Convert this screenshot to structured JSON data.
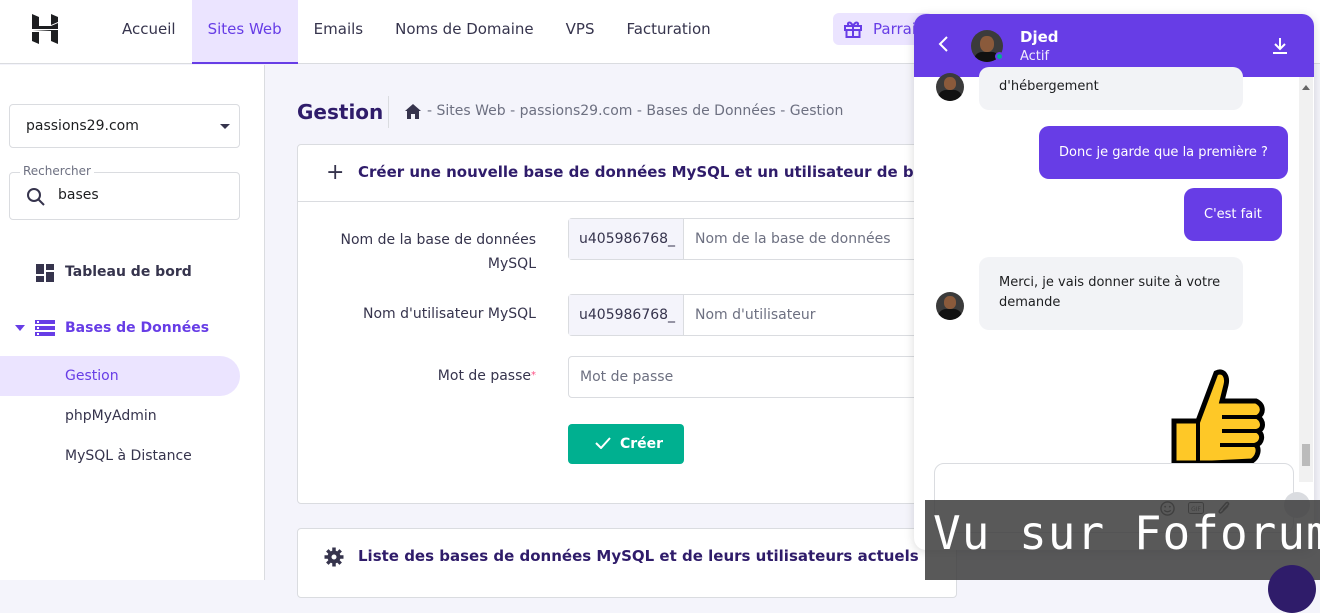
{
  "topbar": {
    "nav": [
      "Accueil",
      "Sites Web",
      "Emails",
      "Noms de Domaine",
      "VPS",
      "Facturation"
    ],
    "active_nav": "Sites Web",
    "referral_label": "Parrai"
  },
  "sidebar": {
    "domain": "passions29.com",
    "search_label": "Rechercher",
    "search_value": "bases",
    "dashboard_label": "Tableau de bord",
    "section_label": "Bases de Données",
    "subitems": [
      "Gestion",
      "phpMyAdmin",
      "MySQL à Distance"
    ]
  },
  "main": {
    "title": "Gestion",
    "breadcrumb": "- Sites Web - passions29.com - Bases de Données - Gestion",
    "create_card": {
      "title": "Créer une nouvelle base de données MySQL et un utilisateur de base de",
      "db_label_1": "Nom de la base de données",
      "db_label_2": "MySQL",
      "db_prefix": "u405986768_",
      "db_placeholder": "Nom de la base de données",
      "user_label": "Nom d'utilisateur MySQL",
      "user_prefix": "u405986768_",
      "user_placeholder": "Nom d'utilisateur",
      "password_label": "Mot de passe",
      "password_required": "*",
      "password_placeholder": "Mot de passe",
      "submit_label": "Créer"
    },
    "list_card_title": "Liste des bases de données MySQL et de leurs utilisateurs actuels"
  },
  "chat": {
    "agent_name": "Djed",
    "agent_status": "Actif",
    "messages": [
      {
        "from": "agent",
        "text": "d'hébergement"
      },
      {
        "from": "user",
        "text": "Donc je garde que la première ?"
      },
      {
        "from": "user",
        "text": "C'est fait"
      },
      {
        "from": "agent",
        "text_1": "Merci, je vais donner suite à votre",
        "text_2": "demande"
      }
    ],
    "composer_icons": [
      "smile-icon",
      "gif-icon",
      "paperclip-icon"
    ]
  },
  "watermark": "Vu sur Foforum",
  "colors": {
    "accent": "#673de6",
    "accent_light": "#ebe4ff",
    "success": "#00b090",
    "text": "#2f1c6a"
  }
}
